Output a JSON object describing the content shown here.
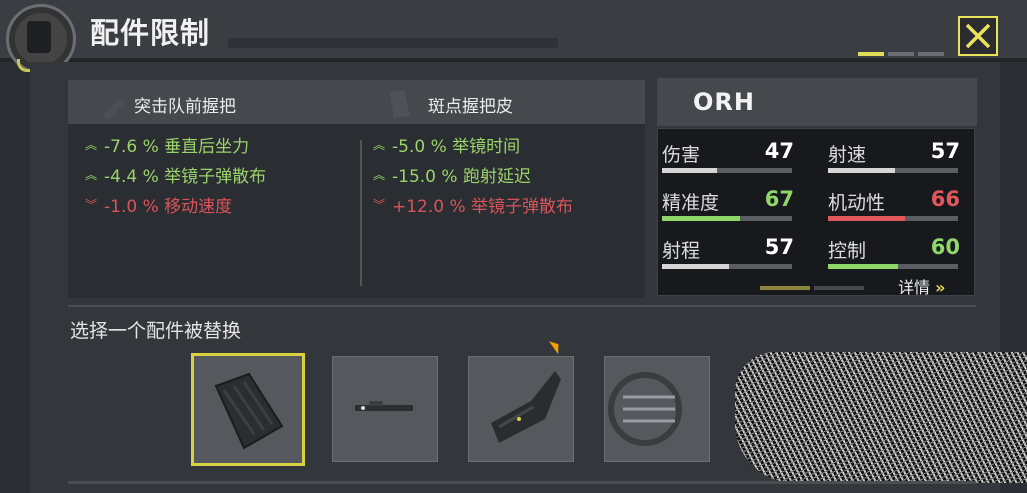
{
  "header": {
    "title": "配件限制"
  },
  "compare": {
    "left": {
      "title": "突击队前握把",
      "stats": [
        {
          "dir": "up",
          "text": "-7.6 % 垂直后坐力"
        },
        {
          "dir": "up",
          "text": "-4.4 % 举镜子弹散布"
        },
        {
          "dir": "down",
          "text": "-1.0 % 移动速度"
        }
      ]
    },
    "right": {
      "title": "斑点握把皮",
      "stats": [
        {
          "dir": "up",
          "text": "-5.0 % 举镜时间"
        },
        {
          "dir": "up",
          "text": "-15.0 % 跑射延迟"
        },
        {
          "dir": "down",
          "text": "+12.0 % 举镜子弹散布"
        }
      ]
    }
  },
  "gun": {
    "name": "ORH",
    "stats": [
      {
        "name": "伤害",
        "value": "47",
        "level": 0.47,
        "color": "#ffffff"
      },
      {
        "name": "射速",
        "value": "57",
        "level": 0.57,
        "color": "#ffffff"
      },
      {
        "name": "精准度",
        "value": "67",
        "level": 0.67,
        "color": "#8fd66b"
      },
      {
        "name": "机动性",
        "value": "66",
        "level": 0.66,
        "color": "#e0575c"
      },
      {
        "name": "射程",
        "value": "57",
        "level": 0.57,
        "color": "#ffffff"
      },
      {
        "name": "控制",
        "value": "60",
        "level": 0.6,
        "color": "#8fd66b"
      }
    ],
    "details_label": "详情"
  },
  "select": {
    "title": "选择一个配件被替换"
  },
  "slots": [
    {
      "icon": "foregrip-icon",
      "selected": true
    },
    {
      "icon": "laser-sight-icon",
      "selected": false
    },
    {
      "icon": "grip-tape-icon",
      "selected": false
    },
    {
      "icon": "ammo-icon",
      "selected": false
    }
  ],
  "colors": {
    "accent": "#e2dd59",
    "positive": "#9bd36b",
    "negative": "#d9545a"
  }
}
